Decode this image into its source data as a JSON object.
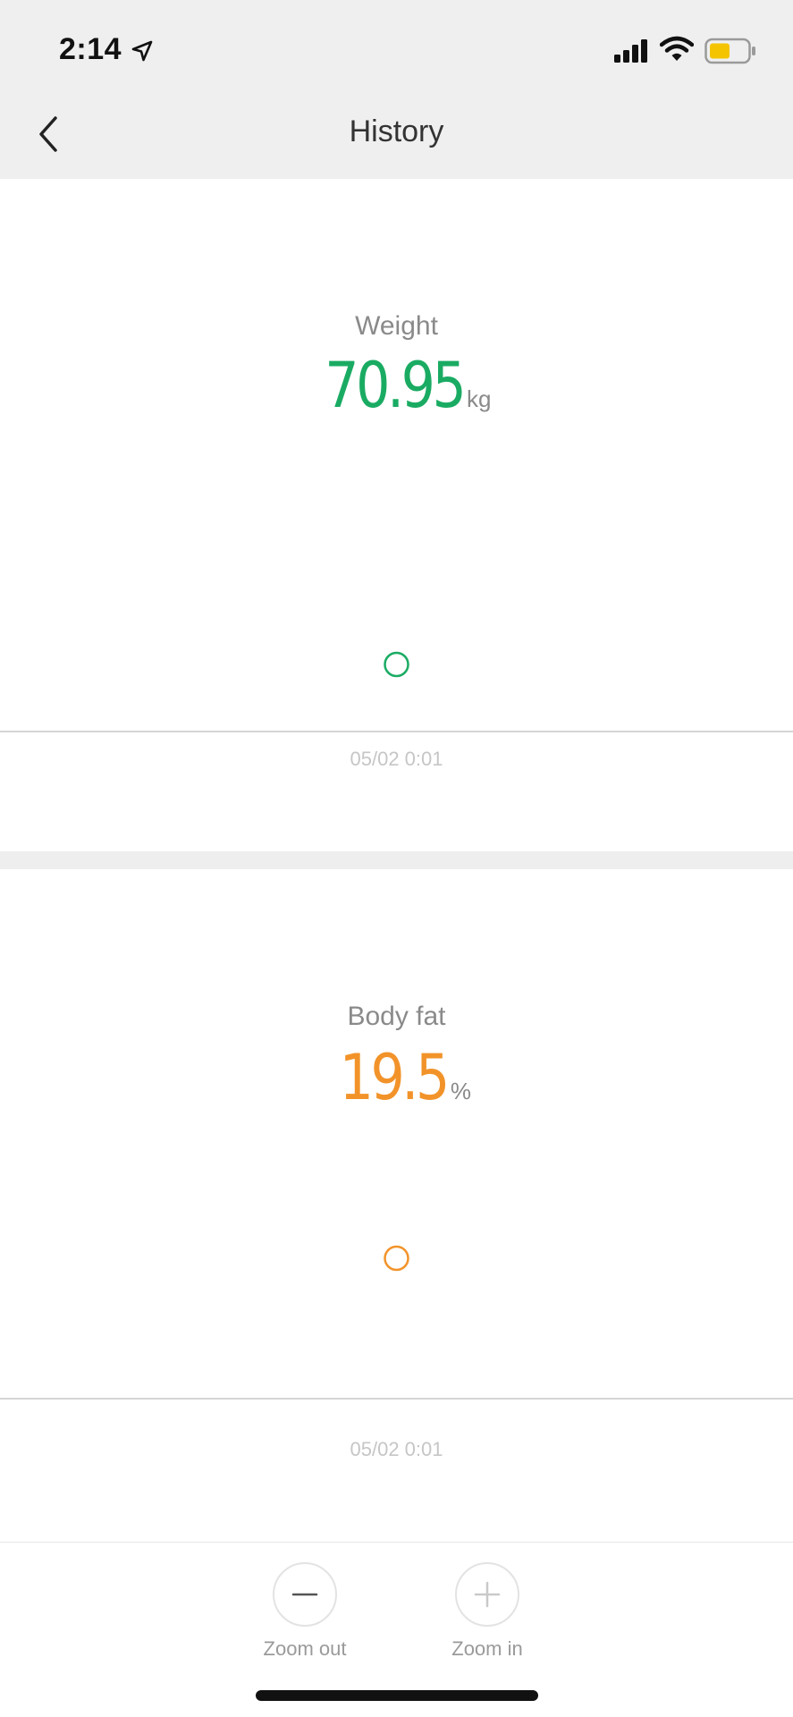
{
  "status_bar": {
    "time": "2:14",
    "icons": [
      "location-arrow-icon",
      "cellular-signal-icon",
      "wifi-icon",
      "battery-icon"
    ],
    "battery_color": "#f5c400"
  },
  "nav": {
    "title": "History",
    "back_icon": "chevron-left-icon"
  },
  "weight": {
    "label": "Weight",
    "value": "70.95",
    "unit": "kg",
    "color": "#1aab63",
    "chart_data": {
      "type": "scatter",
      "x": [
        "05/02 0:01"
      ],
      "values": [
        70.95
      ]
    },
    "date_label": "05/02 0:01"
  },
  "body_fat": {
    "label": "Body fat",
    "value": "19.5",
    "unit": "%",
    "color": "#f2932a",
    "chart_data": {
      "type": "scatter",
      "x": [
        "05/02 0:01"
      ],
      "values": [
        19.5
      ]
    },
    "date_label": "05/02 0:01"
  },
  "toolbar": {
    "zoom_out": {
      "label": "Zoom out",
      "icon": "minus-icon"
    },
    "zoom_in": {
      "label": "Zoom in",
      "icon": "plus-icon"
    }
  }
}
